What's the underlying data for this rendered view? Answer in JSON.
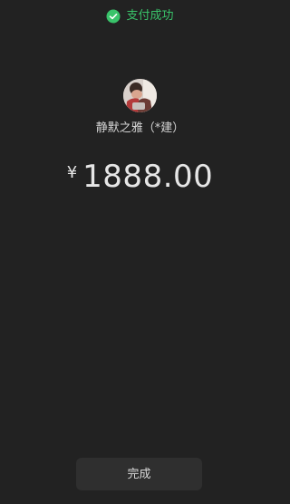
{
  "status": {
    "text": "支付成功",
    "icon": "wechat-pay-icon",
    "color": "#39c36a"
  },
  "payee": {
    "name": "静默之雅（*建）",
    "avatar": "payee-avatar-photo"
  },
  "payment": {
    "currency_symbol": "¥",
    "amount": "1888.00"
  },
  "actions": {
    "done_label": "完成"
  },
  "colors": {
    "background": "#222222",
    "button": "#2f2f2f"
  }
}
